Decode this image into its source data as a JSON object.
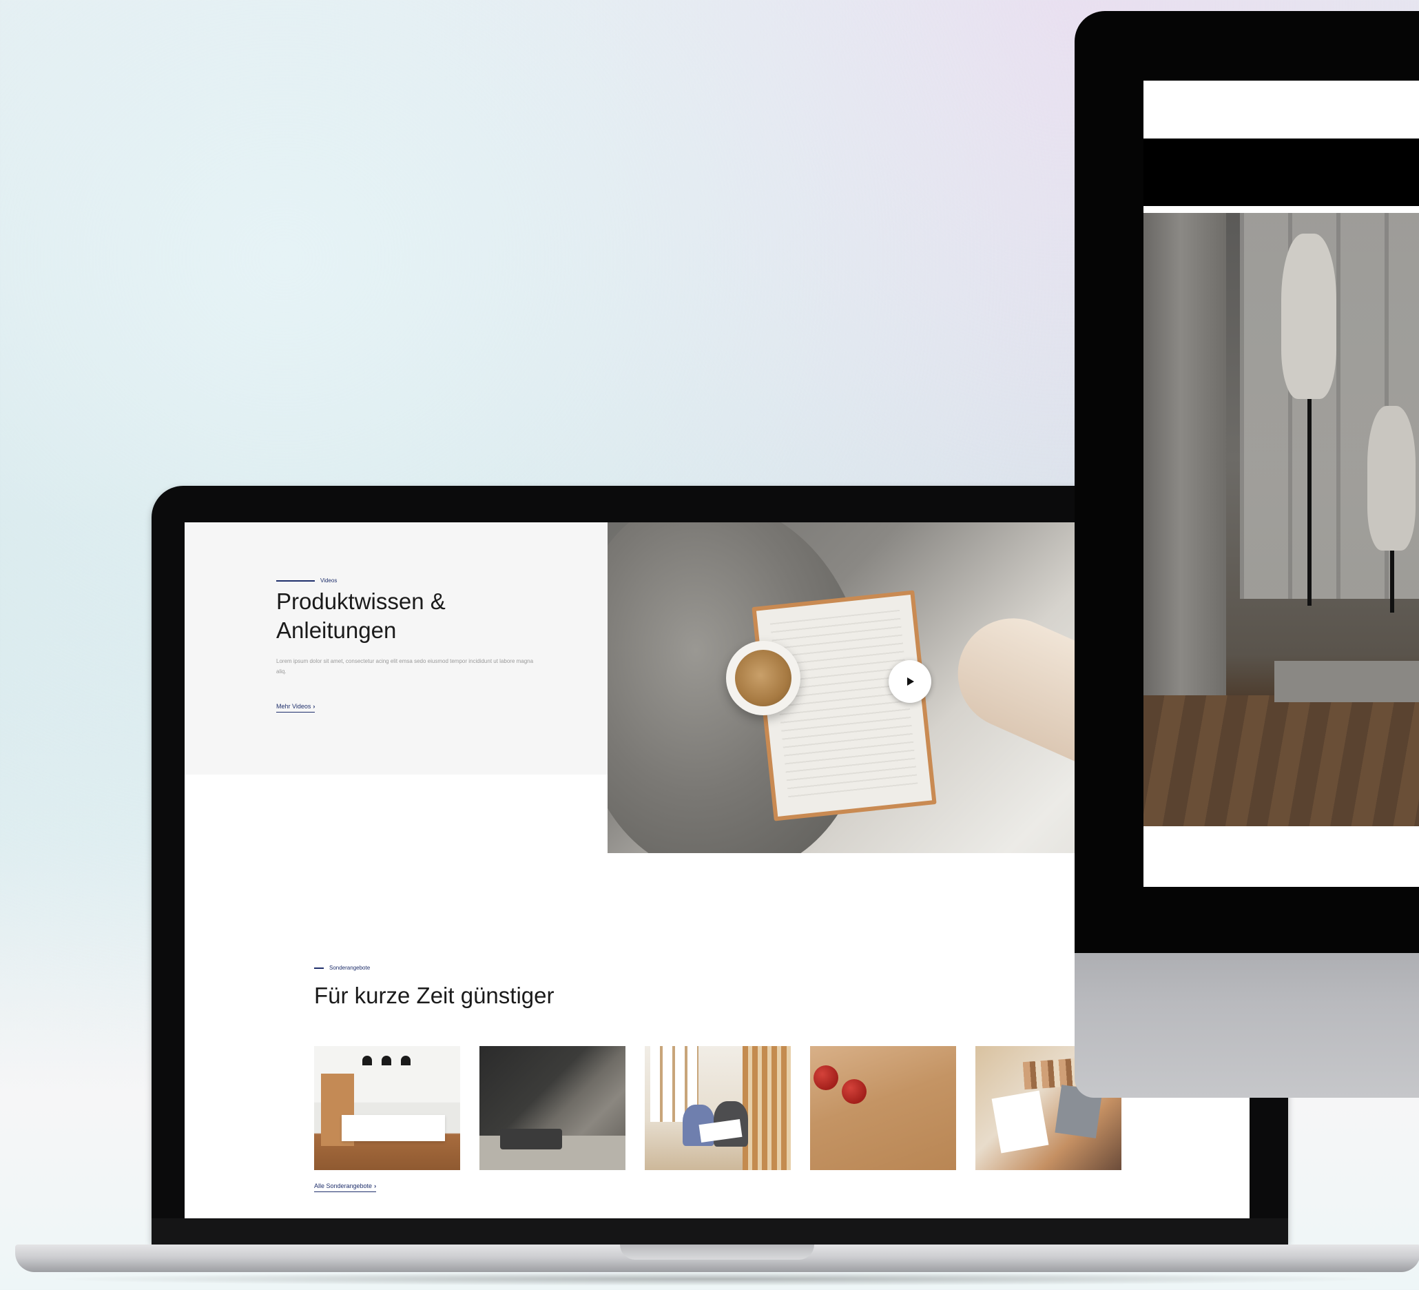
{
  "videos_section": {
    "eyebrow": "Videos",
    "title": "Produktwissen & Anleitungen",
    "description": "Lorem ipsum dolor sit amet, consectetur acing elit emsa sedo eiusmod tempor incididunt ut labore magna aliq.",
    "link_label": "Mehr Videos",
    "play_icon": "play-icon"
  },
  "offers_section": {
    "eyebrow": "Sonderangebote",
    "title": "Für kurze Zeit günstiger",
    "link_label": "Alle Sonderangebote",
    "items": [
      {
        "image": "kitchen"
      },
      {
        "image": "living-room"
      },
      {
        "image": "people-with-plans"
      },
      {
        "image": "apples-on-wood"
      },
      {
        "image": "material-samples"
      }
    ]
  },
  "colors": {
    "accent": "#1f2f6b",
    "panel_bg": "#f6f6f6",
    "text": "#1b1b1b"
  }
}
